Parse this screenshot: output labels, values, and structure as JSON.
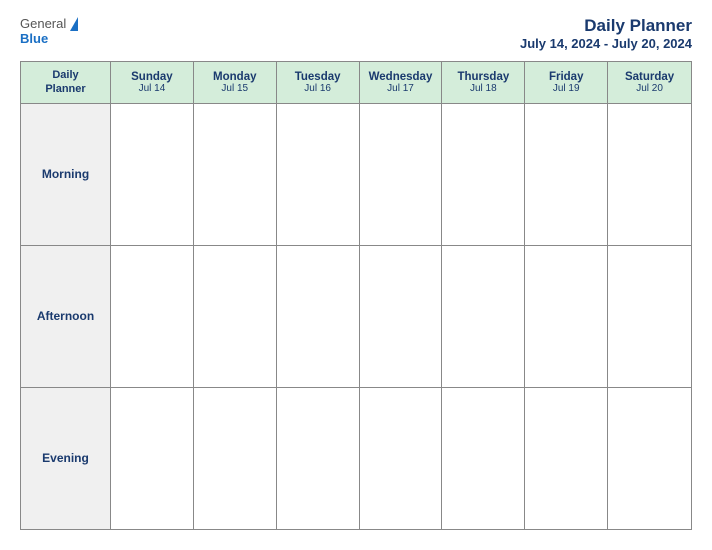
{
  "header": {
    "logo_general": "General",
    "logo_blue": "Blue",
    "title": "Daily Planner",
    "date_range": "July 14, 2024 - July 20, 2024"
  },
  "calendar": {
    "header_label_line1": "Daily",
    "header_label_line2": "Planner",
    "days": [
      {
        "name": "Sunday",
        "date": "Jul 14"
      },
      {
        "name": "Monday",
        "date": "Jul 15"
      },
      {
        "name": "Tuesday",
        "date": "Jul 16"
      },
      {
        "name": "Wednesday",
        "date": "Jul 17"
      },
      {
        "name": "Thursday",
        "date": "Jul 18"
      },
      {
        "name": "Friday",
        "date": "Jul 19"
      },
      {
        "name": "Saturday",
        "date": "Jul 20"
      }
    ],
    "rows": [
      {
        "label": "Morning"
      },
      {
        "label": "Afternoon"
      },
      {
        "label": "Evening"
      }
    ]
  }
}
